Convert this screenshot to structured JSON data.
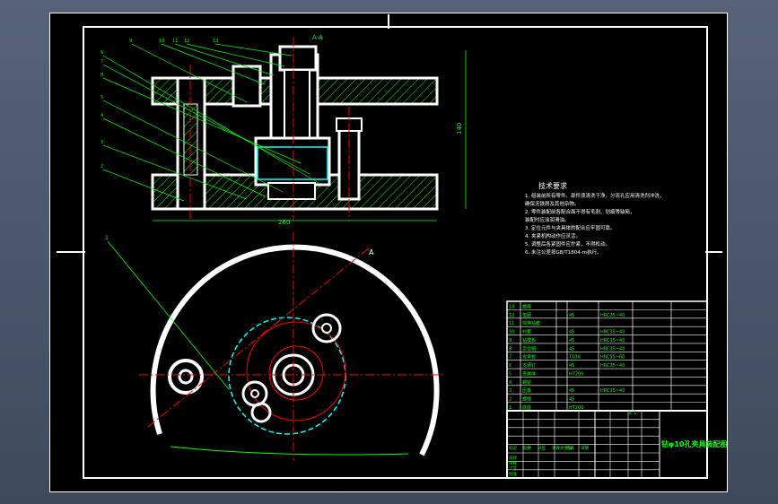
{
  "drawing": {
    "section_label": "A-A",
    "dim_width": "260",
    "dim_height": "140",
    "section_marker": "A",
    "part_callouts": [
      "9",
      "10",
      "11",
      "12",
      "13",
      "6",
      "7",
      "8",
      "5",
      "4",
      "3",
      "2",
      "1"
    ],
    "plan_callout": "1"
  },
  "tech_requirements": {
    "title": "技术要求",
    "lines": [
      "1. 组装前所有零件、部件须清洗干净，分流孔应用清洗剂冲洗，",
      "   确保无铁屑及其他杂物。",
      "2. 零件装配前各配合面不得有毛刺、划痕等缺陷，",
      "   装配时应涂润滑油。",
      "3. 定位元件与夹具体的配合应牢固可靠。",
      "4. 夹紧机构动作应灵活。",
      "5. 调整后各紧固件应拧紧，不得松动。",
      "6. 未注公差按GB/T1804-m执行。"
    ]
  },
  "bom": {
    "rows": [
      {
        "no": "13",
        "name": "螺母",
        "qty": "",
        "material": "",
        "std": "",
        "note": ""
      },
      {
        "no": "12",
        "name": "垫圈",
        "qty": "",
        "material": "45",
        "std": "HRC35~40",
        "note": ""
      },
      {
        "no": "11",
        "name": "快换钻套",
        "qty": "",
        "material": "",
        "std": "",
        "note": ""
      },
      {
        "no": "10",
        "name": "衬套",
        "qty": "",
        "material": "45",
        "std": "HRC35~40",
        "note": ""
      },
      {
        "no": "9",
        "name": "钻模板",
        "qty": "",
        "material": "45",
        "std": "HRC35~40",
        "note": ""
      },
      {
        "no": "8",
        "name": "定位销",
        "qty": "",
        "material": "45",
        "std": "HRC35~40",
        "note": ""
      },
      {
        "no": "7",
        "name": "支承板",
        "qty": "",
        "material": "T10A",
        "std": "HRC55~60",
        "note": ""
      },
      {
        "no": "6",
        "name": "支承钉",
        "qty": "",
        "material": "45",
        "std": "HRC35~40",
        "note": ""
      },
      {
        "no": "5",
        "name": "夹具体",
        "qty": "",
        "material": "HT200",
        "std": "",
        "note": ""
      },
      {
        "no": "4",
        "name": "螺钉",
        "qty": "",
        "material": "",
        "std": "",
        "note": ""
      },
      {
        "no": "3",
        "name": "压板",
        "qty": "",
        "material": "45",
        "std": "HRC35~40",
        "note": ""
      },
      {
        "no": "2",
        "name": "螺栓",
        "qty": "",
        "material": "45",
        "std": "",
        "note": ""
      },
      {
        "no": "1",
        "name": "底座",
        "qty": "",
        "material": "HT200",
        "std": "",
        "note": ""
      }
    ]
  },
  "title_block": {
    "drawing_title": "钻φ10孔夹具装配图",
    "scale": "1:1",
    "labels": [
      "标记",
      "处数",
      "分区",
      "更改文件号",
      "签名",
      "日期"
    ],
    "roles": [
      "设计",
      "审核",
      "工艺",
      "批准"
    ]
  },
  "colors": {
    "sheet": "#000000",
    "frame": "#ffffff",
    "leader": "#00ff00",
    "center": "#ff0000",
    "hidden": "#00ffff",
    "hatch": "#00ff00",
    "text": "#ffffff",
    "table_text": "#00ff00"
  }
}
